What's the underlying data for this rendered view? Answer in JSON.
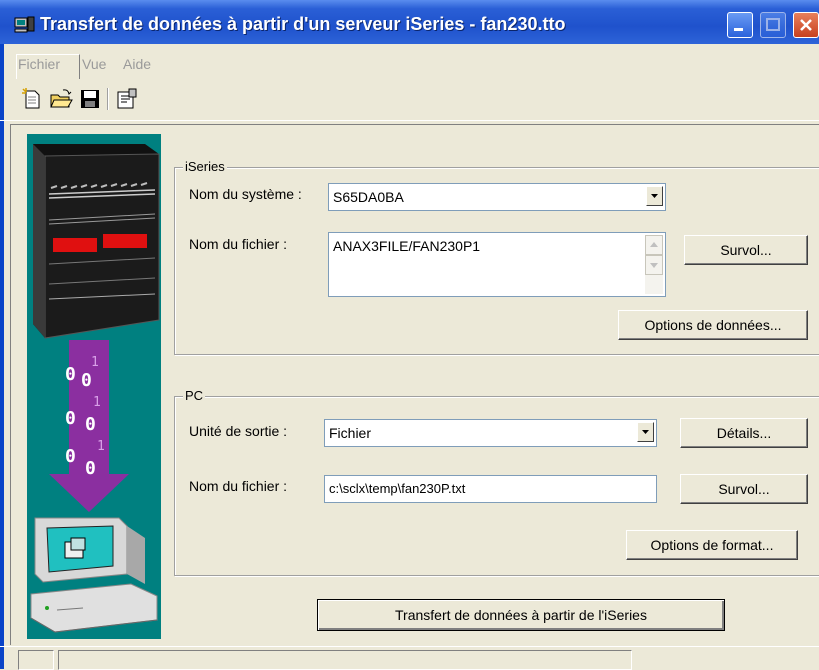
{
  "window": {
    "title": "Transfert de données à partir d'un serveur iSeries - fan230.tto",
    "title_bar_color": "#1f52cc"
  },
  "menu": {
    "items": [
      {
        "label": "Fichier",
        "mnemonic": "F"
      },
      {
        "label": "Vue",
        "mnemonic": "V"
      },
      {
        "label": "Aide",
        "mnemonic": "A"
      }
    ]
  },
  "toolbar": {
    "buttons": [
      {
        "icon": "new-document-icon"
      },
      {
        "icon": "open-folder-icon"
      },
      {
        "icon": "save-disk-icon"
      },
      {
        "icon": "properties-icon"
      }
    ]
  },
  "iseries": {
    "group_title": "iSeries",
    "system_label": "Nom du système :",
    "system_value": "S65DA0BA",
    "file_label": "Nom du fichier :",
    "file_value": "ANAX3FILE/FAN230P1",
    "browse_label": "Survol...",
    "data_options_label": "Options de données..."
  },
  "pc": {
    "group_title": "PC",
    "output_label": "Unité de sortie :",
    "output_value": "Fichier",
    "details_label": "Détails...",
    "file_label": "Nom du fichier :",
    "file_value": "c:\\sclx\\temp\\fan230P.txt",
    "browse_label": "Survol...",
    "format_options_label": "Options de format..."
  },
  "transfer_button_label": "Transfert de données à partir de l'iSeries",
  "illustration": {
    "background": "#008080",
    "arrow_color": "#8b2fa0"
  }
}
